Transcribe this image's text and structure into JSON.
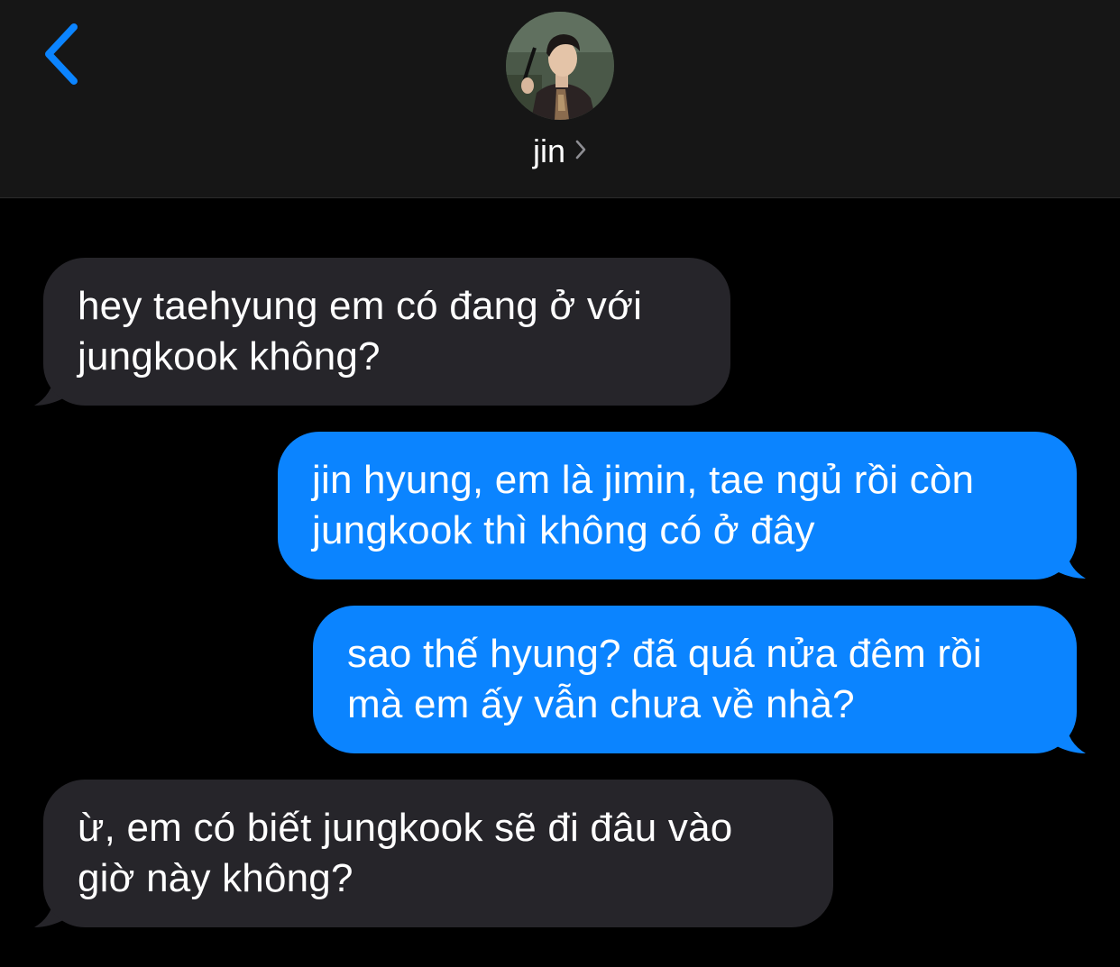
{
  "header": {
    "back_icon": "chevron-left-icon",
    "contact_name": "jin",
    "contact_chevron_icon": "chevron-right-icon",
    "avatar_icon": "contact-photo"
  },
  "colors": {
    "background": "#000000",
    "header_background": "#161616",
    "received_bubble": "#26252a",
    "sent_bubble": "#0b84ff",
    "accent": "#0b84ff"
  },
  "messages": [
    {
      "direction": "received",
      "text": "hey taehyung em có đang ở với jungkook không?"
    },
    {
      "direction": "sent",
      "text": "jin hyung, em là jimin, tae ngủ rồi còn jungkook thì không có ở đây"
    },
    {
      "direction": "sent",
      "text": "sao thế hyung? đã quá nửa đêm rồi mà em ấy vẫn chưa về nhà?"
    },
    {
      "direction": "received",
      "text": "ừ, em có biết jungkook sẽ đi đâu vào giờ này không?"
    }
  ]
}
